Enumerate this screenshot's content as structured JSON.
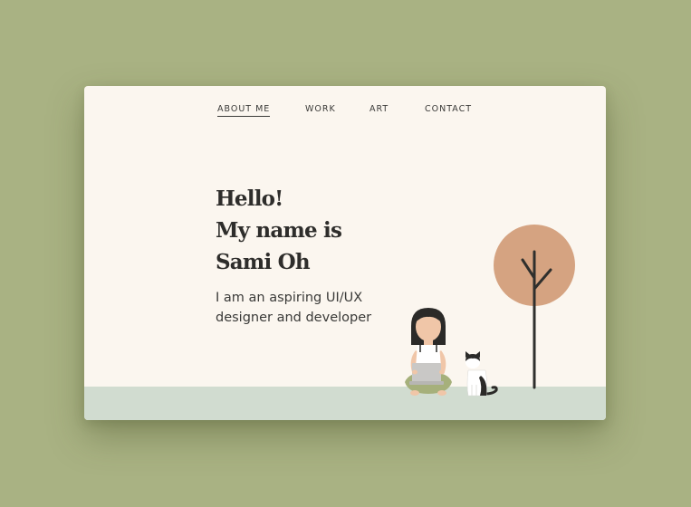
{
  "nav": {
    "items": [
      {
        "label": "ABOUT  ME",
        "active": true
      },
      {
        "label": "WORK",
        "active": false
      },
      {
        "label": "ART",
        "active": false
      },
      {
        "label": "CONTACT",
        "active": false
      }
    ]
  },
  "hero": {
    "title_lines": [
      "Hello!",
      "My name is",
      "Sami Oh"
    ],
    "subtitle": "I am an aspiring UI/UX designer and developer"
  },
  "colors": {
    "page_background": "#a9b283",
    "card_background": "#fbf6ef",
    "ground": "#d1dcd0",
    "tree_canopy": "#d5a381",
    "text": "#2e2d2b"
  },
  "illustration": {
    "figures": [
      "person-with-laptop",
      "cat",
      "tree"
    ]
  }
}
